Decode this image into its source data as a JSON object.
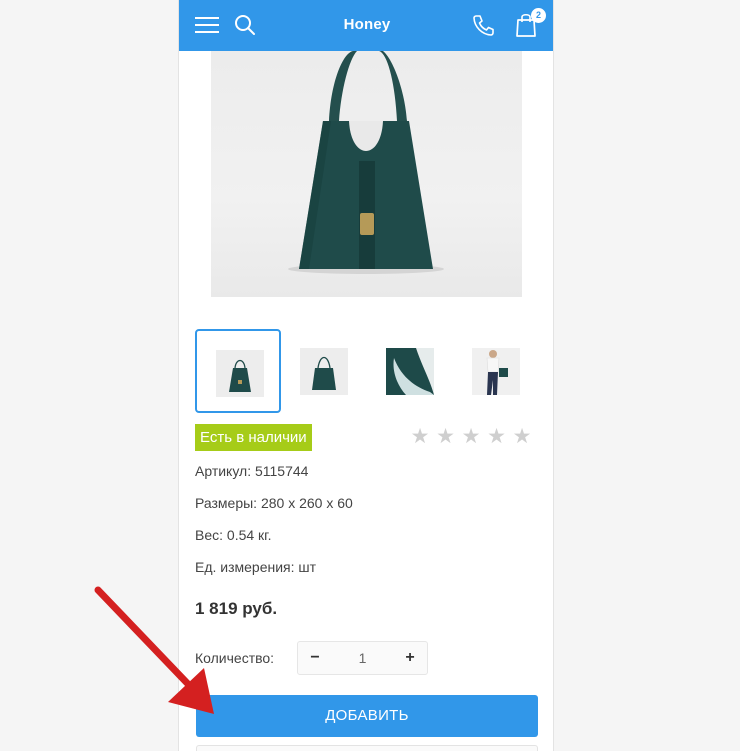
{
  "header": {
    "title": "Honey",
    "cart_count": "2",
    "icons": [
      "menu-icon",
      "search-icon",
      "phone-icon",
      "cart-icon"
    ]
  },
  "product": {
    "stock_label": "Есть в наличии",
    "rating": {
      "stars_filled": 0,
      "stars_total": 5
    },
    "properties": [
      "Артикул: 5115744",
      "Размеры: 280 x 260 x 60",
      "Вес: 0.54 кг.",
      "Ед. измерения: шт"
    ],
    "price": "1 819 руб."
  },
  "quantity": {
    "label": "Количество:",
    "minus": "−",
    "value": "1",
    "plus": "+"
  },
  "add_button": {
    "label": "ДОБАВИТЬ"
  },
  "colors": {
    "accent": "#3197e9",
    "stock": "#a6cc18",
    "bag": "#1f4f4e",
    "arrow": "#d42020"
  }
}
